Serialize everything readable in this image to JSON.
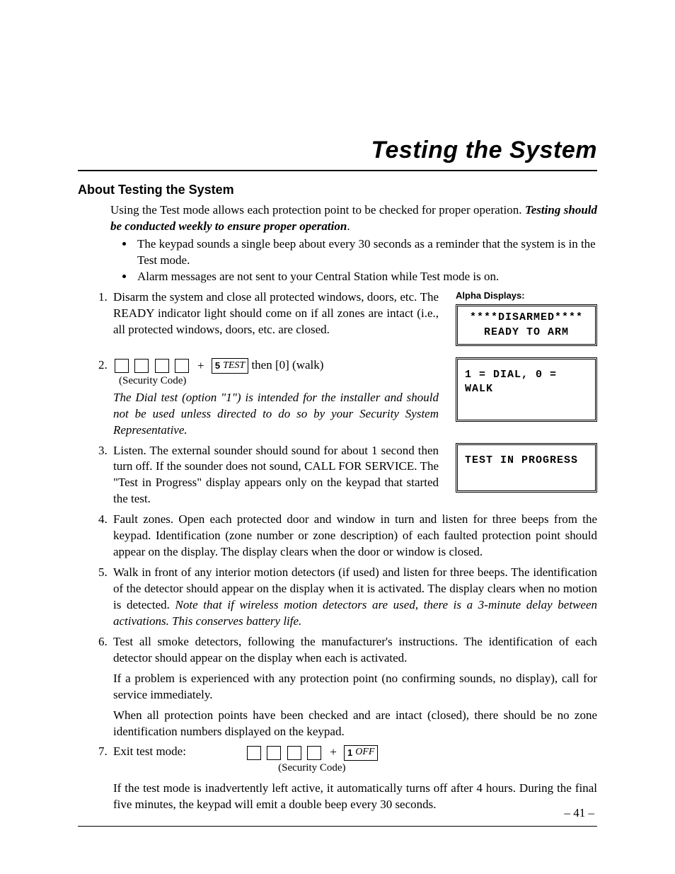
{
  "title": "Testing the System",
  "section_heading": "About Testing the System",
  "intro_line1": "Using the Test mode allows each protection point to be checked for proper operation.",
  "intro_line2_bold_italic": "Testing should be conducted weekly to ensure proper operation",
  "intro_line2_tail": ".",
  "bullets": [
    "The keypad sounds a single beep about every 30 seconds as a reminder that the system is in the Test mode.",
    "Alarm messages are not sent to your Central Station while Test mode is on."
  ],
  "alpha_label": "Alpha Displays:",
  "displays": {
    "disarmed_line1": "****DISARMED****",
    "disarmed_line2": "READY TO ARM",
    "dialwalk": "1 = DIAL, 0 = WALK",
    "testinprogress": "TEST IN PROGRESS"
  },
  "steps": {
    "s1": "Disarm the system and close all protected windows, doors, etc. The READY indicator light should come on if all zones are intact (i.e., all protected windows, doors, etc. are closed.",
    "s2_key_num": "5",
    "s2_key_lbl": "TEST",
    "s2_tail": "  then  [0] (walk)",
    "s2_seccode": "(Security Code)",
    "s2_note_italic": "The Dial test (option \"1\") is intended for the installer and should not be used unless directed to do so by your Security System Representative.",
    "s3": "Listen. The external sounder should sound for about 1 second then turn off. If the sounder does not sound, CALL FOR SERVICE.  The \"Test in Progress\" display appears only on the keypad that started the test.",
    "s4": "Fault zones. Open each protected door and window in turn and listen for three beeps from the keypad. Identification (zone number or zone description) of each faulted protection point should appear on the display. The display clears when the door or window is closed.",
    "s5_a": "Walk in front of any interior motion detectors (if used) and listen for three beeps. The identification of the detector should appear on the display when it is activated. The display clears when no motion is detected. ",
    "s5_b_italic": "Note that if wireless motion detectors are used, there is a 3-minute delay between activations. This conserves battery life.",
    "s6_a": "Test all smoke detectors, following the manufacturer's instructions. The identification of each detector should appear on the display when each is activated.",
    "s6_b": "If a problem is experienced with any protection point (no confirming sounds, no display), call for service immediately.",
    "s6_c": "When all protection points have been checked and are intact (closed), there should be no zone identification numbers displayed on the keypad.",
    "s7_lead": "Exit test mode:",
    "s7_key_num": "1",
    "s7_key_lbl": "OFF",
    "s7_seccode": "(Security Code)",
    "s7_tail_a": "If the test mode is inadvertently left active, it automatically turns off after 4 hours. During the final five minutes, the keypad will emit a double beep every 30 seconds."
  },
  "page_number": "– 41 –"
}
